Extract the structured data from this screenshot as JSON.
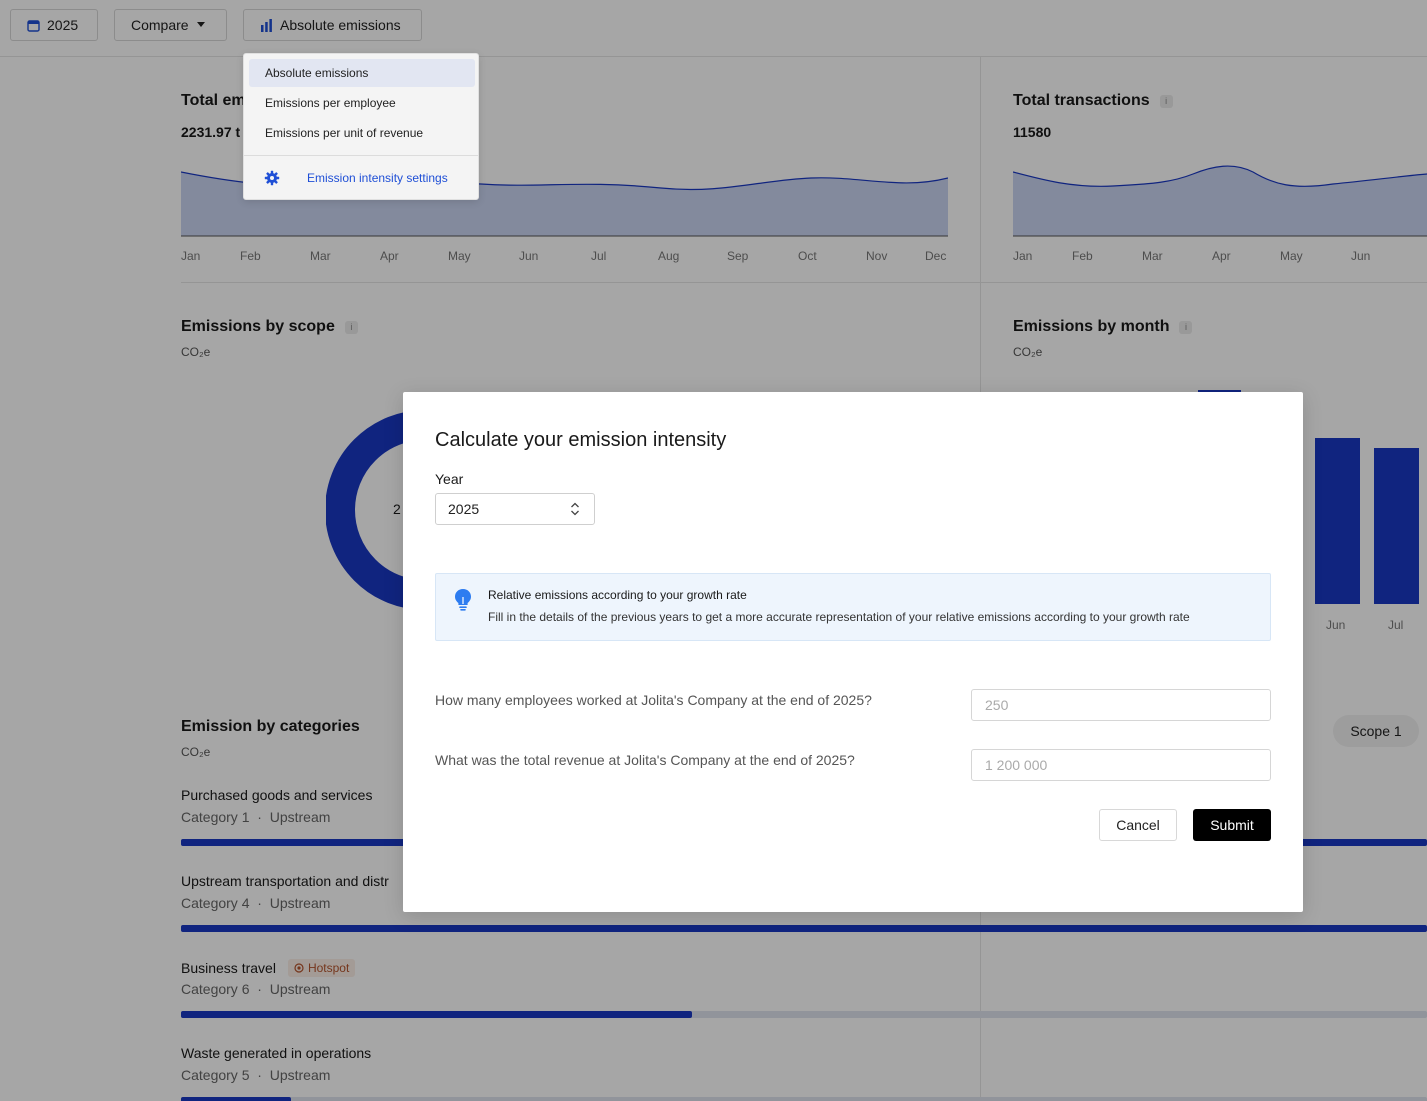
{
  "toolbar": {
    "year_label": "2025",
    "compare_label": "Compare",
    "mode_label": "Absolute emissions"
  },
  "mode_menu": {
    "items": [
      "Absolute emissions",
      "Emissions per employee",
      "Emissions per unit of revenue"
    ],
    "selected": "Absolute emissions",
    "settings_label": "Emission intensity settings"
  },
  "total_emissions": {
    "title": "Total em",
    "value": "2231.97 t",
    "months": [
      "Jan",
      "Feb",
      "Mar",
      "Apr",
      "May",
      "Jun",
      "Jul",
      "Aug",
      "Sep",
      "Oct",
      "Nov",
      "Dec"
    ]
  },
  "total_transactions": {
    "title": "Total transactions",
    "value": "11580",
    "months": [
      "Jan",
      "Feb",
      "Mar",
      "Apr",
      "May",
      "Jun"
    ]
  },
  "emissions_by_scope": {
    "title": "Emissions by scope",
    "unit": "CO₂e",
    "center_label": "2"
  },
  "emissions_by_month": {
    "title": "Emissions by month",
    "unit": "CO₂e",
    "visible_months": [
      "Jun",
      "Jul"
    ]
  },
  "categories": {
    "title": "Emission by categories",
    "unit": "CO₂e",
    "scope_filter": "Scope 1",
    "items": [
      {
        "name": "Purchased goods and services",
        "sub_category": "Category 1",
        "sub_stream": "Upstream",
        "hotspot": "",
        "share": 1.0
      },
      {
        "name": "Upstream transportation and distr",
        "sub_category": "Category 4",
        "sub_stream": "Upstream",
        "hotspot": "",
        "share": 1.0
      },
      {
        "name": "Business travel",
        "sub_category": "Category 6",
        "sub_stream": "Upstream",
        "hotspot": "Hotspot",
        "share": 0.41
      },
      {
        "name": "Waste generated in operations",
        "sub_category": "Category 5",
        "sub_stream": "Upstream",
        "hotspot": "",
        "share": 0.088
      }
    ]
  },
  "modal": {
    "title": "Calculate your emission intensity",
    "year_label": "Year",
    "year_value": "2025",
    "info_title": "Relative emissions according to your growth rate",
    "info_body": "Fill in the details of the previous years to get a more accurate representation of your relative emissions according to your growth rate",
    "q_employees": "How many employees worked at Jolita's Company at the end of 2025?",
    "employees_placeholder": "250",
    "q_revenue": "What was the total revenue at Jolita's Company at the end of 2025?",
    "revenue_placeholder": "1 200 000",
    "cancel_label": "Cancel",
    "submit_label": "Submit"
  },
  "colors": {
    "accent": "#1a38c4",
    "link": "#1f4fd6",
    "hotspot": "#b4542c",
    "info_bg": "#eef5fd"
  }
}
